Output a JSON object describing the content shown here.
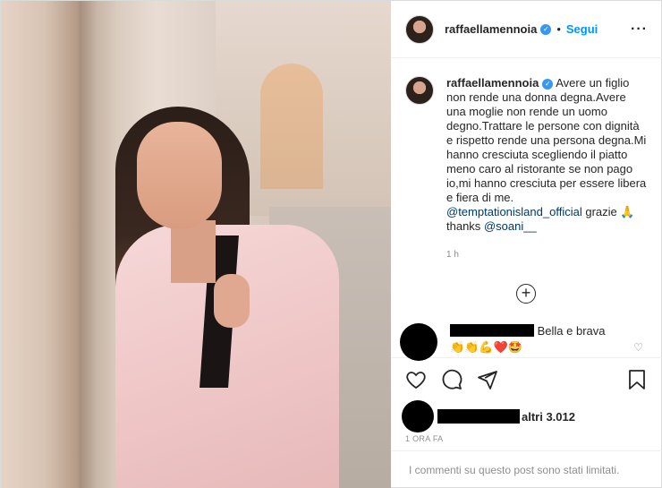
{
  "post": {
    "username": "raffaellamennoia",
    "verified_icon": "verified-badge-icon",
    "follow_label": "Segui",
    "more_icon": "more-options-icon",
    "caption_text": "Avere un figlio non rende una donna degna.Avere una moglie non rende un uomo degno.Trattare le persone con dignità e rispetto rende una persona degna.Mi hanno cresciuta scegliendo il piatto meno caro al ristorante se non pago io,mi hanno cresciuta per essere libera e fiera di me.",
    "mention_1": "@temptationisland_official",
    "caption_mid": "grazie 🙏 thanks",
    "mention_2": "@soani__",
    "time": "1 h"
  },
  "comment": {
    "text": "Bella e brava",
    "emojis": "👏👏💪❤️🤩"
  },
  "likes": {
    "text": "altri 3.012",
    "ago": "1 ORA FA"
  },
  "footer": {
    "limited": "I commenti su questo post sono stati limitati."
  }
}
